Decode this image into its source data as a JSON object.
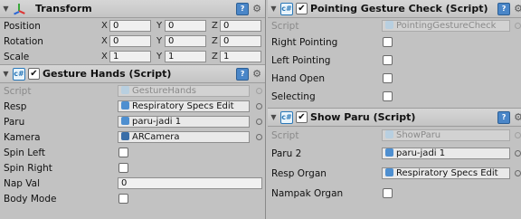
{
  "left": {
    "transform": {
      "title": "Transform",
      "rows": [
        {
          "label": "Position",
          "x": "0",
          "y": "0",
          "z": "0"
        },
        {
          "label": "Rotation",
          "x": "0",
          "y": "0",
          "z": "0"
        },
        {
          "label": "Scale",
          "x": "1",
          "y": "1",
          "z": "1"
        }
      ],
      "axis": {
        "x": "X",
        "y": "Y",
        "z": "Z"
      }
    },
    "gesture_hands": {
      "title": "Gesture Hands (Script)",
      "script_label": "Script",
      "script_value": "GestureHands",
      "resp_label": "Resp",
      "resp_value": "Respiratory Specs Edit",
      "paru_label": "Paru",
      "paru_value": "paru-jadi 1",
      "kamera_label": "Kamera",
      "kamera_value": "ARCamera",
      "spin_left_label": "Spin Left",
      "spin_right_label": "Spin Right",
      "nap_val_label": "Nap Val",
      "nap_val_value": "0",
      "body_mode_label": "Body Mode"
    }
  },
  "right": {
    "pointing": {
      "title": "Pointing Gesture Check (Script)",
      "script_label": "Script",
      "script_value": "PointingGestureCheck",
      "right_pointing_label": "Right Pointing",
      "left_pointing_label": "Left Pointing",
      "hand_open_label": "Hand Open",
      "selecting_label": "Selecting"
    },
    "show_paru": {
      "title": "Show Paru (Script)",
      "script_label": "Script",
      "script_value": "ShowParu",
      "paru2_label": "Paru 2",
      "paru2_value": "paru-jadi 1",
      "resp_organ_label": "Resp Organ",
      "resp_organ_value": "Respiratory Specs Edit",
      "nampak_organ_label": "Nampak Organ"
    }
  },
  "icons": {
    "fold": "▼",
    "check": "✔",
    "gear": "⚙",
    "book": "?"
  },
  "colors": {
    "panel_bg": "#c2c2c2",
    "script_blue": "#2a78b8",
    "object_blue": "#4e8fd0"
  }
}
